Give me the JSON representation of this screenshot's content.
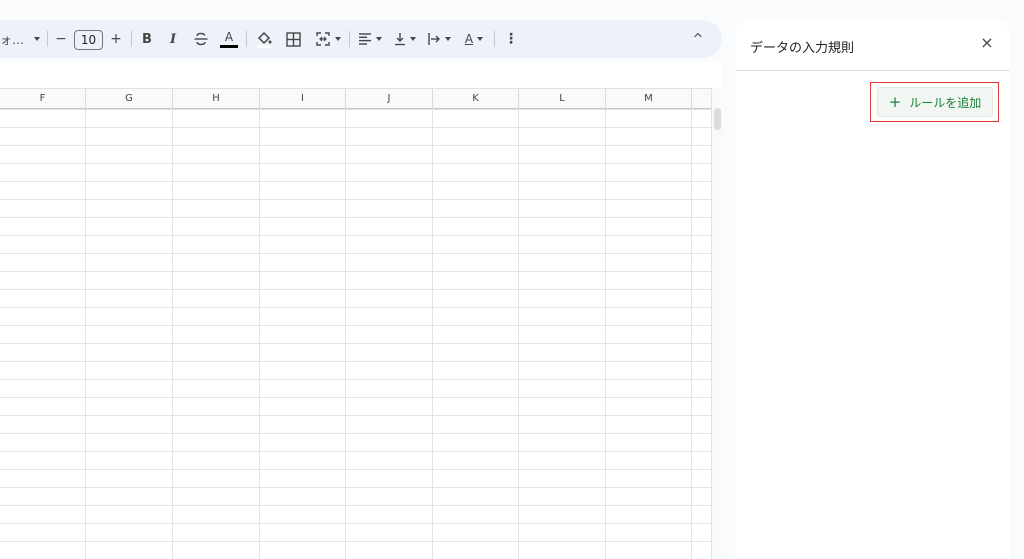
{
  "toolbar": {
    "font_truncated": "ォ…",
    "minus": "−",
    "font_size": "10",
    "plus": "+",
    "bold": "B",
    "italic": "I",
    "text_color_glyph": "A",
    "text_style_glyph": "A",
    "more": "⋮",
    "collapse": "^"
  },
  "sheet": {
    "columns": [
      "F",
      "G",
      "H",
      "I",
      "J",
      "K",
      "L",
      "M"
    ]
  },
  "panel": {
    "title": "データの入力規則",
    "close": "×",
    "add_rule_plus": "+",
    "add_rule_label": "ルールを追加"
  },
  "colors": {
    "accent_green": "#188038",
    "highlight_red": "#e53935",
    "toolbar_bg": "#edf2fa"
  }
}
